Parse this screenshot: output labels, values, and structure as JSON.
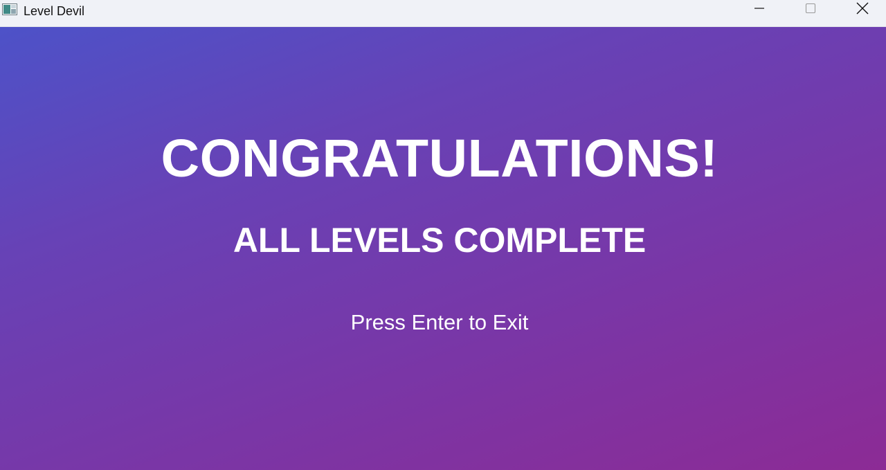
{
  "window": {
    "title": "Level Devil",
    "icon": "app-icon",
    "controls": {
      "minimize_icon": "minimize-icon",
      "maximize_icon": "maximize-icon",
      "close_icon": "close-icon"
    }
  },
  "screen": {
    "headline": "CONGRATULATIONS!",
    "subheadline": "ALL LEVELS COMPLETE",
    "prompt": "Press Enter to Exit"
  },
  "colors": {
    "gradient_start": "#4d52c8",
    "gradient_end": "#8c2b95",
    "text": "#ffffff",
    "titlebar": "#f0f2f7"
  }
}
